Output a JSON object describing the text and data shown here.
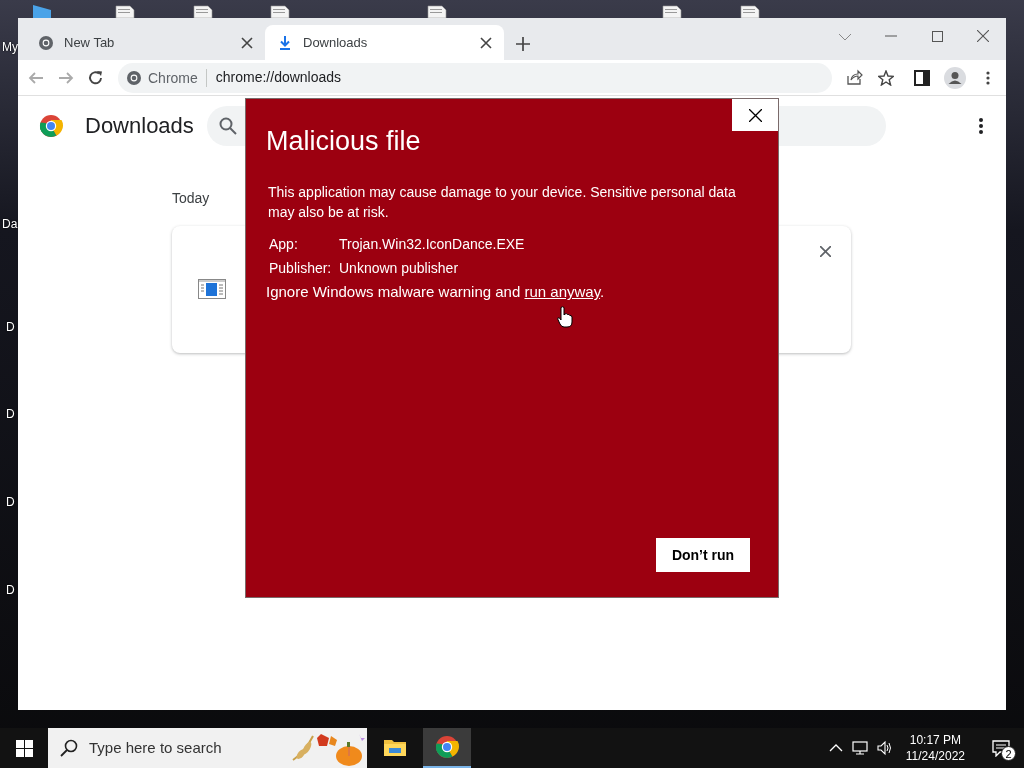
{
  "desktop": {
    "icon_labels": [
      {
        "lines": [
          "My"
        ]
      },
      {
        "lines": [
          "Da"
        ]
      },
      {
        "lines": [
          "D"
        ]
      },
      {
        "lines": [
          "D"
        ]
      },
      {
        "lines": [
          "D"
        ]
      },
      {
        "lines": [
          "D"
        ]
      }
    ]
  },
  "browser": {
    "tabs": [
      {
        "kind": "chrome",
        "title": "New Tab",
        "selected": false
      },
      {
        "kind": "download",
        "title": "Downloads",
        "selected": true
      }
    ],
    "omnibox": {
      "chip": "Chrome",
      "url": "chrome://downloads"
    },
    "page": {
      "title": "Downloads",
      "section": "Today"
    }
  },
  "dialog": {
    "title": "Malicious file",
    "message": "This application may cause damage to your device. Sensitive personal data may also be at risk.",
    "details": [
      {
        "label": "App:",
        "value": "Trojan.Win32.IconDance.EXE"
      },
      {
        "label": "Publisher:",
        "value": "Unknown publisher"
      }
    ],
    "warning_text": "Ignore Windows malware warning and ",
    "warning_link": "run anyway",
    "warning_end": ".",
    "button": "Don’t run"
  },
  "taskbar": {
    "search_placeholder": "Type here to search",
    "apps": [
      {
        "kind": "explorer",
        "active": false
      },
      {
        "kind": "chrome",
        "active": true
      }
    ],
    "time": "10:17 PM",
    "date": "11/24/2022",
    "notification_count": "2"
  }
}
